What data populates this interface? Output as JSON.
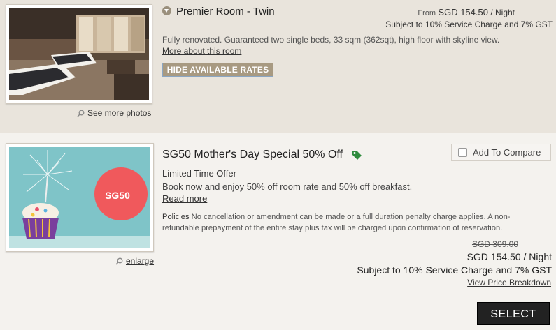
{
  "room": {
    "title": "Premier Room - Twin",
    "price_from_label": "From",
    "price_amount": "SGD 154.50",
    "price_unit": "/ Night",
    "tax_note": "Subject to 10% Service Charge and 7% GST",
    "description": "Fully renovated. Guaranteed two single beds, 33 sqm (362sqt), high floor with skyline view.",
    "more_link": "More about this room",
    "hide_rates_button": "HIDE AVAILABLE RATES",
    "see_more_photos": "See more photos"
  },
  "offer": {
    "title": "SG50 Mother's Day Special 50% Off",
    "compare_label": "Add To Compare",
    "subtitle": "Limited Time Offer",
    "description": "Book now and enjoy 50% off room rate and 50% off breakfast.",
    "read_more": "Read more",
    "policies_label": "Policies",
    "policies_text": "No cancellation or amendment can be made or a full duration penalty charge applies. A non-refundable prepayment of the entire stay plus tax will be charged upon confirmation of reservation.",
    "old_price": "SGD 309.00",
    "new_price": "SGD 154.50",
    "new_price_unit": "/ Night",
    "tax_note": "Subject to 10% Service Charge and 7% GST",
    "breakdown_link": "View Price Breakdown",
    "select_button": "SELECT",
    "enlarge_link": "enlarge",
    "badge_text": "SG50"
  },
  "colors": {
    "room_bg": "#e9e4dc",
    "button_tan": "#a89a82",
    "badge_red": "#f0595c",
    "tag_green": "#2e8b3d",
    "select_bg": "#222222"
  },
  "icons": {
    "chevron": "chevron-down-circle-icon",
    "tag": "tag-icon",
    "magnifier": "magnifier-icon",
    "checkbox": "checkbox-icon"
  }
}
